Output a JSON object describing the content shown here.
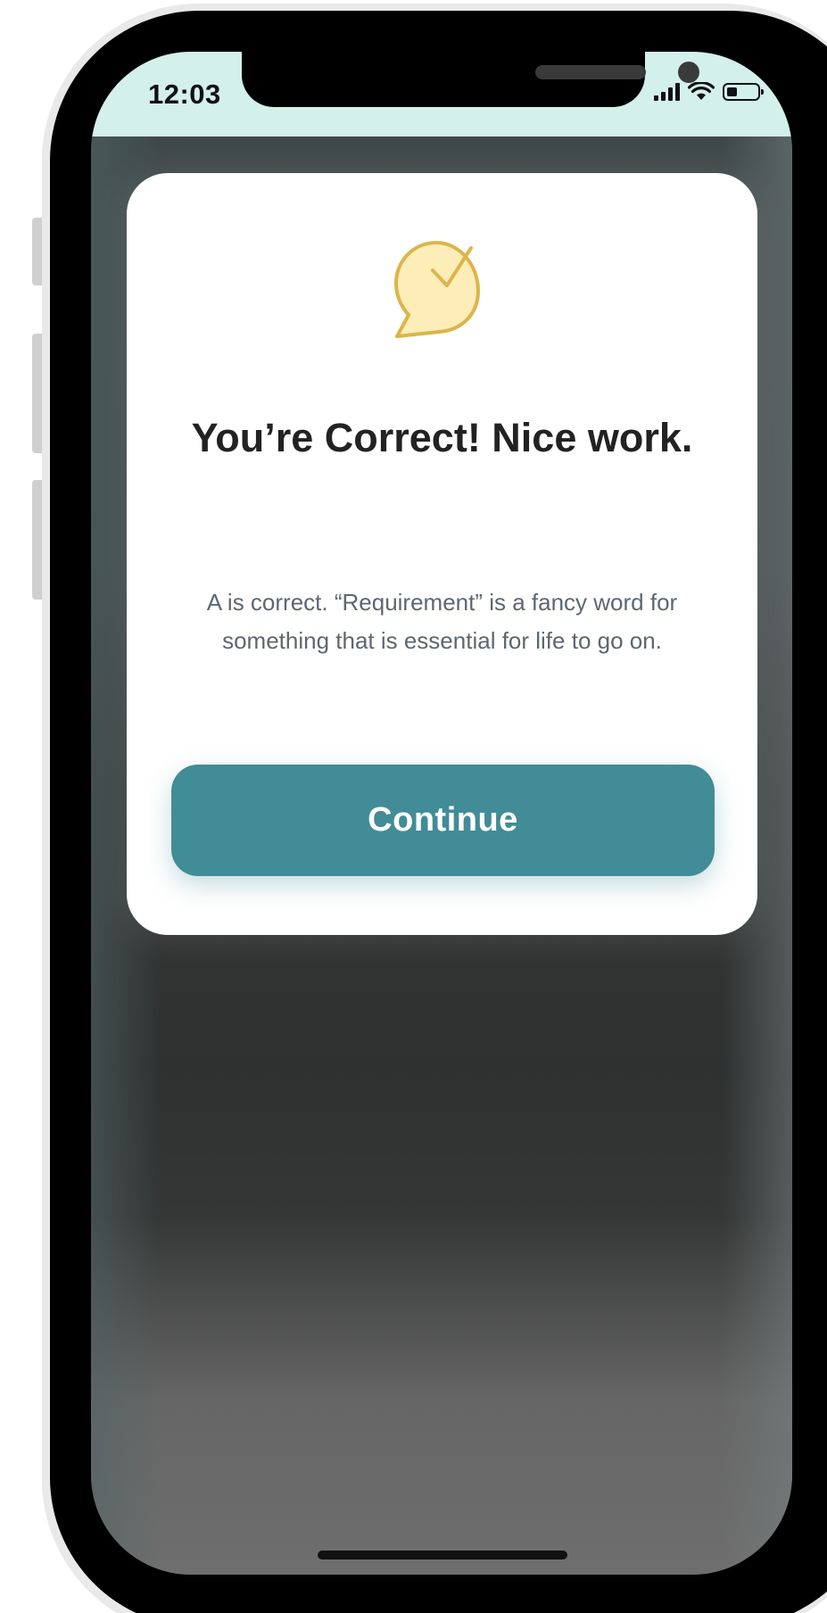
{
  "status_bar": {
    "time": "12:03",
    "icons": [
      "cellular-signal-icon",
      "wifi-icon",
      "battery-icon"
    ],
    "battery_level": 0.25
  },
  "modal": {
    "icon": "speech-bubble-check-icon",
    "title": "You’re Correct! Nice work.",
    "body": "A is correct. “Requirement” is a fancy word for something that is essential for life to go on.",
    "continue_label": "Continue"
  },
  "colors": {
    "status_background": "#d4f0eb",
    "accent": "#418c96",
    "icon_fill": "#fdedb8",
    "icon_stroke": "#dcb54a",
    "title_text": "#222222",
    "body_text": "#5d6770"
  }
}
